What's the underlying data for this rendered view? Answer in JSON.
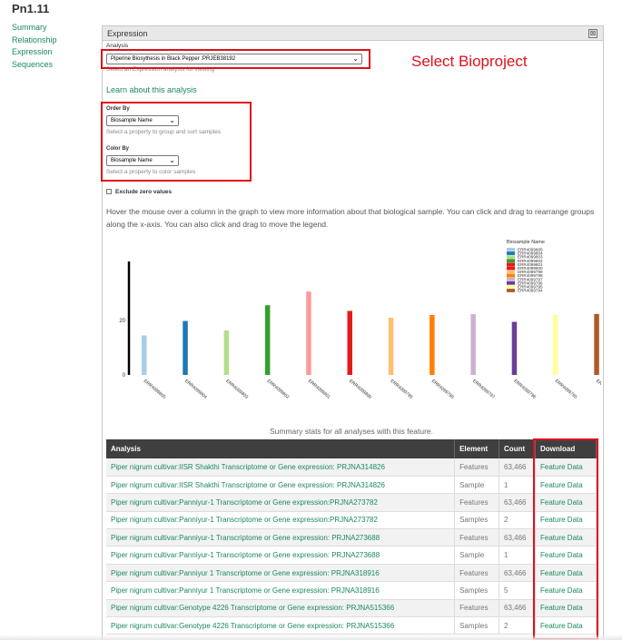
{
  "page": {
    "title": "Pn1.11"
  },
  "sidenav": {
    "items": [
      "Summary",
      "Relationship",
      "Expression",
      "Sequences"
    ]
  },
  "panel": {
    "title": "Expression",
    "close_glyph": "⊠"
  },
  "analysis": {
    "label": "Analysis",
    "selected": "Piperine Biosythesis in Black Pepper :PRJEB38192",
    "help": "Select an Expression analysis for viewing"
  },
  "annotation": {
    "select_bioproject": "Select Bioproject"
  },
  "learn_link": "Learn about this analysis",
  "order_by": {
    "label": "Order By",
    "selected": "Biosample Name",
    "help": "Select a property to group and sort samples"
  },
  "color_by": {
    "label": "Color By",
    "selected": "Biosample Name",
    "help": "Select a property to color samples"
  },
  "exclude_zero": "Exclude zero values",
  "hover_text": "Hover the mouse over a column in the graph to view more information about that biological sample. You can click and drag to rearrange groups along the x-axis. You can also click and drag to move the legend.",
  "chart_data": {
    "type": "bar",
    "legend_title": "Biosample Name",
    "legend_placement": "top-right",
    "yticks": [
      "0",
      "20"
    ],
    "ylim": [
      0,
      40
    ],
    "categories": [
      "ERR4099805",
      "ERR4099804",
      "ERR4099803",
      "ERR4099802",
      "ERR4099801",
      "ERR4099800",
      "ERR4099799",
      "ERR4099798",
      "ERR4099797",
      "ERR4099796",
      "ERR4099795",
      "ER"
    ],
    "values": [
      14.5,
      19.8,
      16.3,
      25.6,
      30.6,
      23.5,
      21.0,
      22.0,
      22.3,
      19.5,
      22.0,
      22.4
    ],
    "colors": [
      "#a6cee3",
      "#1f78b4",
      "#b2df8a",
      "#33a02c",
      "#fb9a99",
      "#e31a1c",
      "#fdbf6f",
      "#ff7f00",
      "#cab2d6",
      "#6a3d9a",
      "#ffff99",
      "#b15928"
    ],
    "legend_entries": [
      "ERR4099805",
      "ERR4099804",
      "ERR4099803",
      "ERR4099802",
      "ERR4099801",
      "ERR4099800",
      "ERR4099799",
      "ERR4099798",
      "ERR4099797",
      "ERR4099796",
      "ERR4099795",
      "ERR4099794"
    ],
    "legend_colors": [
      "#a6cee3",
      "#1f78b4",
      "#b2df8a",
      "#33a02c",
      "#e31a1c",
      "#e31a1c",
      "#fdbf6f",
      "#ff7f00",
      "#cab2d6",
      "#6a3d9a",
      "#ffff99",
      "#b15928"
    ]
  },
  "stats": {
    "caption": "Summary stats for all analyses with this feature.",
    "headers": [
      "Analysis",
      "Element",
      "Count",
      "Download"
    ],
    "rows": [
      [
        "Piper nigrum cultivar:IISR Shakthi Transcriptome or Gene expression: PRJNA314826",
        "Features",
        "63,466",
        "Feature Data"
      ],
      [
        "Piper nigrum cultivar:IISR Shakthi Transcriptome or Gene expression: PRJNA314826",
        "Sample",
        "1",
        "Feature Data"
      ],
      [
        "Piper nigrum cultivar:Panniyur-1 Transcriptome or Gene expression:PRJNA273782",
        "Features",
        "63,466",
        "Feature Data"
      ],
      [
        "Piper nigrum cultivar:Panniyur-1 Transcriptome or Gene expression:PRJNA273782",
        "Samples",
        "2",
        "Feature Data"
      ],
      [
        "Piper nigrum cultivar:Panniyur-1 Transcriptome or Gene expression: PRJNA273688",
        "Features",
        "63,466",
        "Feature Data"
      ],
      [
        "Piper nigrum cultivar:Panniyur-1 Transcriptome or Gene expression: PRJNA273688",
        "Sample",
        "1",
        "Feature Data"
      ],
      [
        "Piper nigrum cultivar:Panniyur 1 Transcriptome or Gene expression: PRJNA318916",
        "Features",
        "63,466",
        "Feature Data"
      ],
      [
        "Piper nigrum cultivar:Panniyur 1 Transcriptome or Gene expression: PRJNA318916",
        "Samples",
        "5",
        "Feature Data"
      ],
      [
        "Piper nigrum cultivar:Genotype 4226 Transcriptome or Gene expression: PRJNA515366",
        "Features",
        "63,466",
        "Feature Data"
      ],
      [
        "Piper nigrum cultivar:Genotype 4226 Transcriptome or Gene expression: PRJNA515366",
        "Samples",
        "2",
        "Feature Data"
      ]
    ]
  },
  "colors": {
    "accent": "#1a8a5c",
    "annotation_red": "#e0101a",
    "table_header": "#3f3f3f"
  }
}
